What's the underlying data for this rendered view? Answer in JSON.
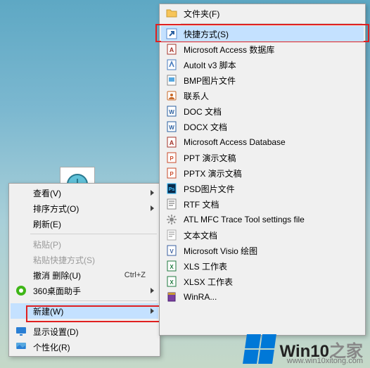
{
  "main_menu": {
    "view": "查看(V)",
    "sort": "排序方式(O)",
    "refresh": "刷新(E)",
    "paste": "粘贴(P)",
    "paste_shortcut": "粘贴快捷方式(S)",
    "undo_delete": "撤消 删除(U)",
    "undo_delete_key": "Ctrl+Z",
    "desktop_helper": "360桌面助手",
    "new": "新建(W)",
    "display_settings": "显示设置(D)",
    "personalize": "个性化(R)"
  },
  "sub_menu": {
    "items": [
      {
        "id": "folder",
        "label": "文件夹(F)"
      },
      {
        "id": "shortcut",
        "label": "快捷方式(S)",
        "highlighted": true
      },
      {
        "id": "access-db-cn",
        "label": "Microsoft Access 数据库"
      },
      {
        "id": "autoit",
        "label": "AutoIt v3 脚本"
      },
      {
        "id": "bmp",
        "label": "BMP图片文件"
      },
      {
        "id": "contact",
        "label": "联系人"
      },
      {
        "id": "doc",
        "label": "DOC 文档"
      },
      {
        "id": "docx",
        "label": "DOCX 文档"
      },
      {
        "id": "access-db-en",
        "label": "Microsoft Access Database"
      },
      {
        "id": "ppt",
        "label": "PPT 演示文稿"
      },
      {
        "id": "pptx",
        "label": "PPTX 演示文稿"
      },
      {
        "id": "psd",
        "label": "PSD图片文件"
      },
      {
        "id": "rtf",
        "label": "RTF 文档"
      },
      {
        "id": "atlmfc",
        "label": "ATL MFC Trace Tool settings file"
      },
      {
        "id": "txt",
        "label": "文本文档"
      },
      {
        "id": "visio",
        "label": "Microsoft Visio 绘图"
      },
      {
        "id": "xls",
        "label": "XLS 工作表"
      },
      {
        "id": "xlsx",
        "label": "XLSX 工作表"
      },
      {
        "id": "winrar",
        "label": "WinRA..."
      }
    ]
  },
  "watermark": {
    "brand_a": "Win10",
    "brand_b": "之家",
    "url": "www.win10xitong.com"
  }
}
